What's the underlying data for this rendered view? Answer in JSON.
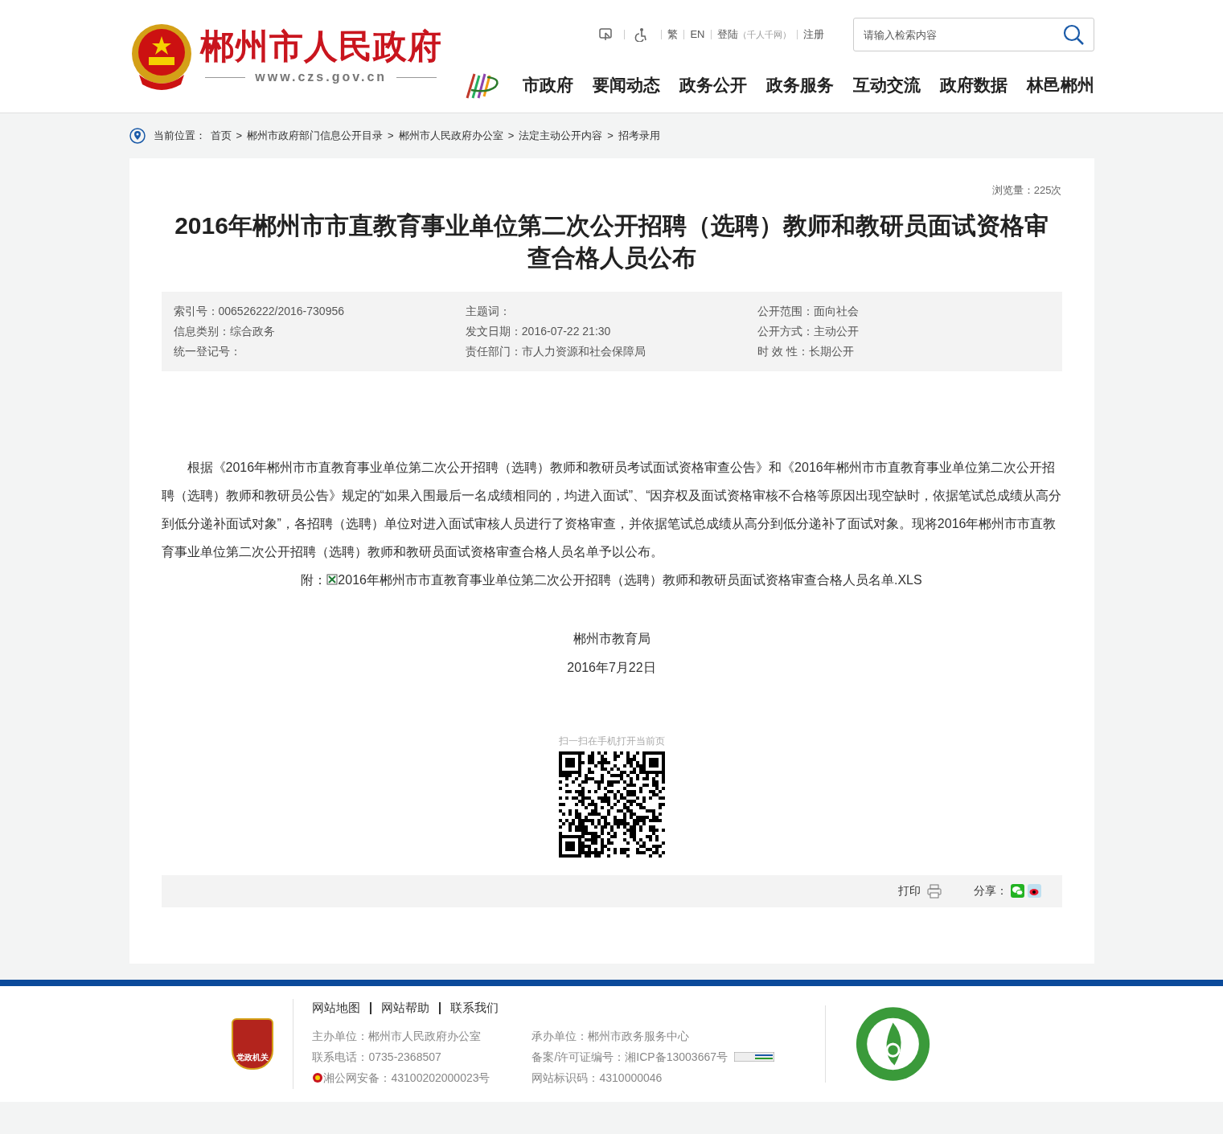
{
  "header": {
    "site_name": "郴州市人民政府",
    "site_url": "www.czs.gov.cn",
    "top_links": [
      {
        "label": "繁"
      },
      {
        "label": "EN"
      },
      {
        "label": "登陆",
        "note": "（千人千网）"
      },
      {
        "label": "注册"
      }
    ],
    "search": {
      "placeholder": "请输入检索内容"
    },
    "nav": [
      "市政府",
      "要闻动态",
      "政务公开",
      "政务服务",
      "互动交流",
      "政府数据",
      "林邑郴州"
    ]
  },
  "breadcrumb": {
    "label": "当前位置：",
    "separator": ">",
    "items": [
      "首页",
      "郴州市政府部门信息公开目录",
      "郴州市人民政府办公室",
      "法定主动公开内容",
      "招考录用"
    ]
  },
  "article": {
    "views": "浏览量：225次",
    "title": "2016年郴州市市直教育事业单位第二次公开招聘（选聘）教师和教研员面试资格审查合格人员公布",
    "meta": [
      [
        "索引号：006526222/2016-730956",
        "主题词：",
        "公开范围：面向社会"
      ],
      [
        "信息类别：综合政务",
        "发文日期：2016-07-22 21:30",
        "公开方式：主动公开"
      ],
      [
        "统一登记号：",
        "责任部门：市人力资源和社会保障局",
        "时 效 性：长期公开"
      ]
    ],
    "body": "根据《2016年郴州市市直教育事业单位第二次公开招聘（选聘）教师和教研员考试面试资格审查公告》和《2016年郴州市市直教育事业单位第二次公开招聘（选聘）教师和教研员公告》规定的“如果入围最后一名成绩相同的，均进入面试”、“因弃权及面试资格审核不合格等原因出现空缺时，依据笔试总成绩从高分到低分递补面试对象”，各招聘（选聘）单位对进入面试审核人员进行了资格审查，并依据笔试总成绩从高分到低分递补了面试对象。现将2016年郴州市市直教育事业单位第二次公开招聘（选聘）教师和教研员面试资格审查合格人员名单予以公布。",
    "attachment_label": "附：",
    "attachment": "2016年郴州市市直教育事业单位第二次公开招聘（选聘）教师和教研员面试资格审查合格人员名单.XLS",
    "signature": "郴州市教育局",
    "date": "2016年7月22日",
    "qr_caption": "扫一扫在手机打开当前页",
    "print": "打印",
    "share": "分享："
  },
  "footer": {
    "links": [
      "网站地图",
      "网站帮助",
      "联系我们"
    ],
    "left_info": [
      "主办单位：郴州市人民政府办公室",
      "联系电话：0735-2368507",
      "湘公网安备：43100202000023号"
    ],
    "right_info": [
      "承办单位：郴州市政务服务中心",
      "备案/许可证编号：湘ICP备13003667号",
      "网站标识码：4310000046"
    ],
    "badge_text": "党政机关"
  }
}
